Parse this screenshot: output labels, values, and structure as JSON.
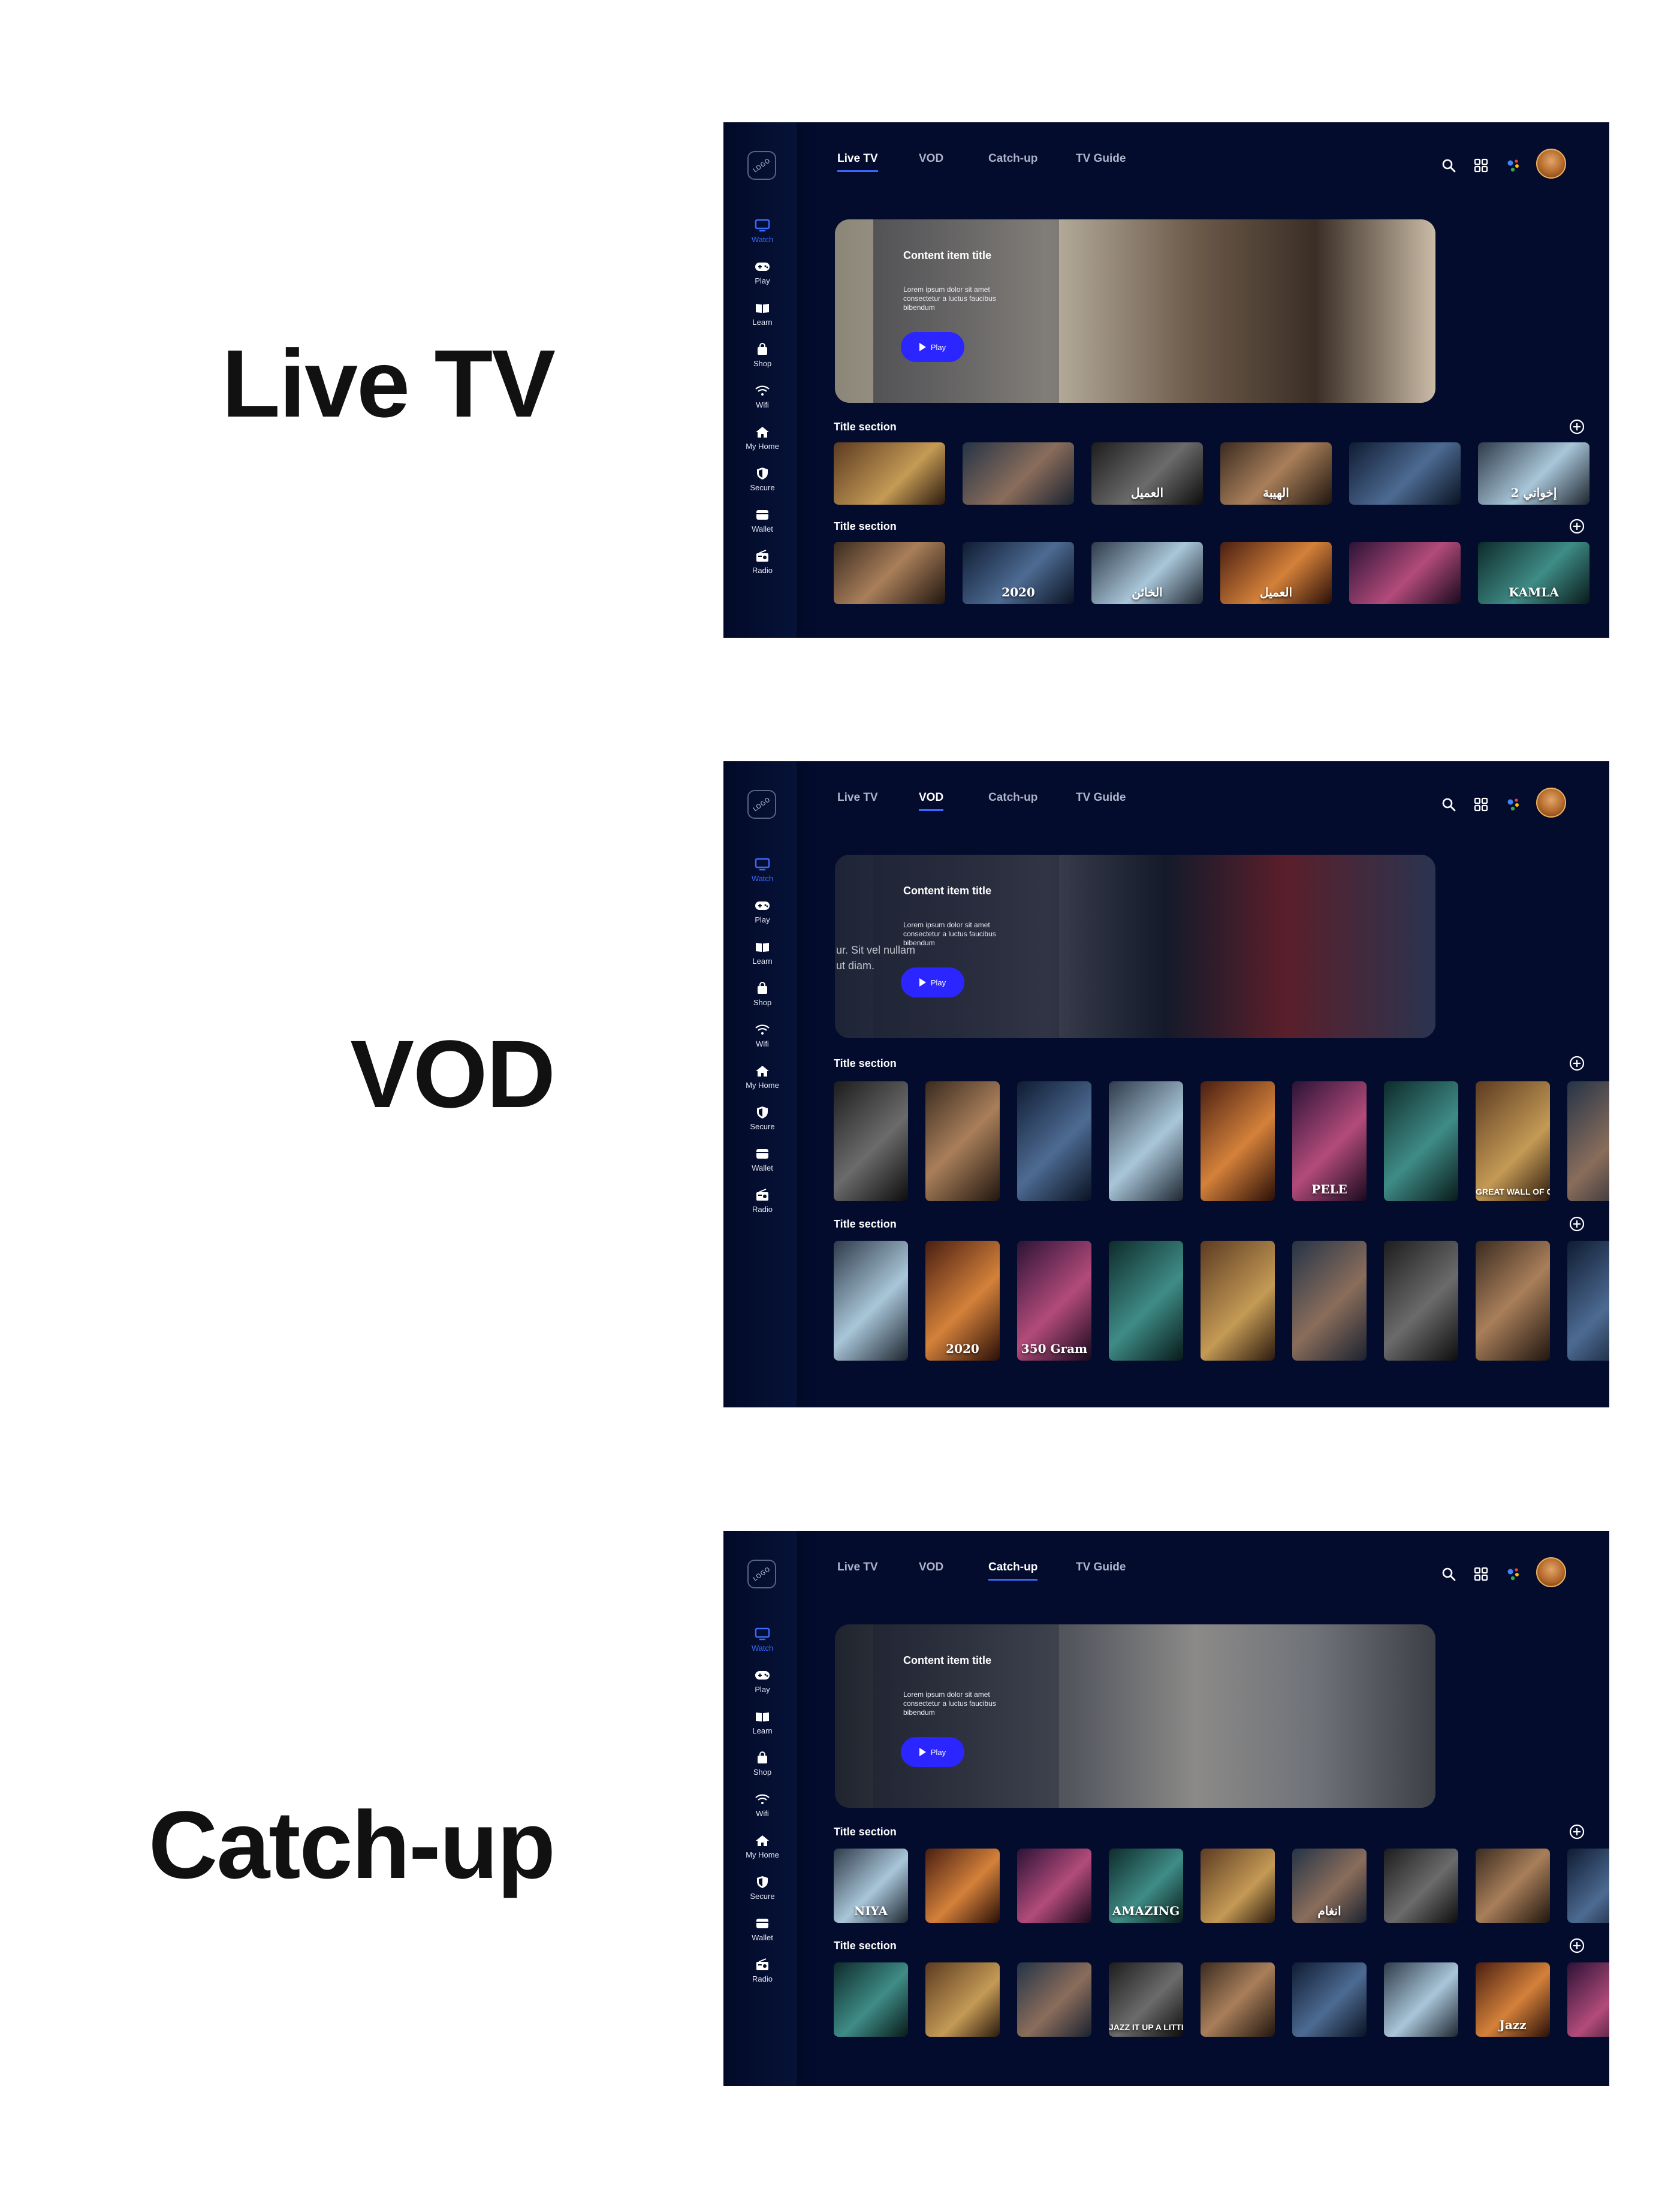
{
  "labels": {
    "live": "Live TV",
    "vod": "VOD",
    "catchup": "Catch-up"
  },
  "app": {
    "logo_text": "LOGO",
    "sidebar": [
      {
        "label": "Watch",
        "icon": "tv-icon"
      },
      {
        "label": "Play",
        "icon": "gamepad-icon"
      },
      {
        "label": "Learn",
        "icon": "book-icon"
      },
      {
        "label": "Shop",
        "icon": "shopping-bag-icon"
      },
      {
        "label": "Wifi",
        "icon": "wifi-icon"
      },
      {
        "label": "My Home",
        "icon": "home-icon"
      },
      {
        "label": "Secure",
        "icon": "shield-icon"
      },
      {
        "label": "Wallet",
        "icon": "wallet-icon"
      },
      {
        "label": "Radio",
        "icon": "radio-icon"
      }
    ],
    "tabs": [
      "Live TV",
      "VOD",
      "Catch-up",
      "TV Guide"
    ],
    "top_icons": [
      "search-icon",
      "grid-icon",
      "assistant-icon",
      "avatar"
    ],
    "hero": {
      "title": "Content item title",
      "description": "Lorem ipsum dolor sit amet consectetur a luctus faucibus bibendum",
      "play_label": "Play"
    },
    "section_title": "Title section",
    "colors": {
      "background": "#040c2e",
      "accent": "#3b66ff",
      "play_button": "#2b25ff"
    }
  },
  "screens": {
    "live": {
      "active_tab": "Live TV",
      "hero_overlay_text": "",
      "row1_captions": [
        "",
        "",
        "العميل",
        "الهيبة",
        "",
        "إخواتي 2"
      ],
      "row2_captions": [
        "",
        "2020",
        "الخائن",
        "العميل",
        "",
        "KAMLA"
      ]
    },
    "vod": {
      "active_tab": "VOD",
      "hero_overlay_text": "ur. Sit vel nullam ut diam.",
      "row1_captions": [
        "",
        "",
        "",
        "",
        "",
        "PELE",
        "",
        "GREAT WALL OF CHINA",
        ""
      ],
      "row2_captions": [
        "",
        "2020",
        "350 Gram",
        "",
        "",
        "",
        "",
        "",
        ""
      ]
    },
    "catchup": {
      "active_tab": "Catch-up",
      "hero_overlay_text": "",
      "row1_captions": [
        "NIYA",
        "",
        "",
        "AMAZING",
        "",
        "انغام",
        "",
        "",
        ""
      ],
      "row2_captions": [
        "",
        "",
        "",
        "JAZZ IT UP A LITTLE",
        "",
        "",
        "",
        "Jazz",
        ""
      ]
    }
  }
}
